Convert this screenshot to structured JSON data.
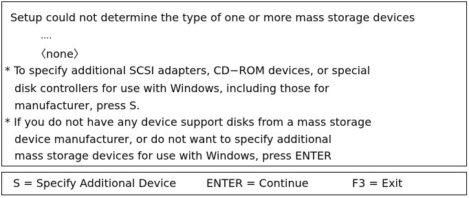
{
  "dialog": {
    "heading": "Setup could not determine the type of one or more mass storage devices",
    "detected_placeholder": "....",
    "none_entry": "〈none〉",
    "note1": {
      "line1": "* To specify additional SCSI adapters, CD−ROM devices, or special",
      "line2": "disk controllers for use with Windows, including those for",
      "line3": "manufacturer, press S."
    },
    "note2": {
      "line1": "* If you do not have any device support disks from a mass storage",
      "line2": "device manufacturer, or do not want to specify additional",
      "line3": "mass storage devices for use with Windows, press ENTER"
    }
  },
  "status_bar": {
    "specify": "S = Specify Additional Device",
    "continue": "ENTER = Continue",
    "exit": "F3 = Exit"
  }
}
